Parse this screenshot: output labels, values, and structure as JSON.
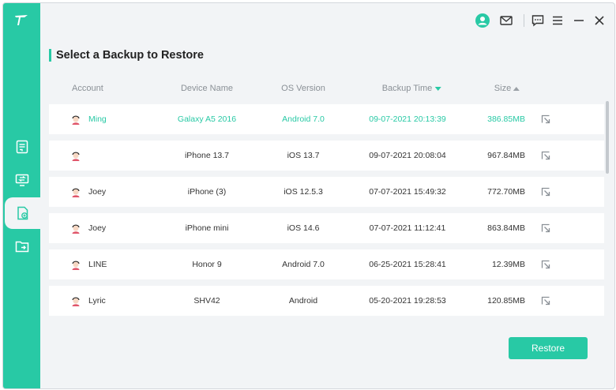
{
  "header": {
    "title": "Select a Backup to Restore"
  },
  "table": {
    "columns": {
      "account": "Account",
      "device": "Device Name",
      "os": "OS Version",
      "time": "Backup Time",
      "size": "Size"
    },
    "sort": {
      "time": "descending",
      "size": "ascending"
    },
    "rows": [
      {
        "account": "Ming",
        "device": "Galaxy A5 2016",
        "os": "Android 7.0",
        "time": "09-07-2021 20:13:39",
        "size": "386.85MB",
        "selected": true
      },
      {
        "account": "",
        "device": "iPhone 13.7",
        "os": "iOS 13.7",
        "time": "09-07-2021 20:08:04",
        "size": "967.84MB",
        "selected": false
      },
      {
        "account": "Joey",
        "device": "iPhone (3)",
        "os": "iOS 12.5.3",
        "time": "07-07-2021 15:49:32",
        "size": "772.70MB",
        "selected": false
      },
      {
        "account": "Joey",
        "device": "iPhone mini",
        "os": "iOS 14.6",
        "time": "07-07-2021 11:12:41",
        "size": "863.84MB",
        "selected": false
      },
      {
        "account": "LINE",
        "device": "Honor 9",
        "os": "Android 7.0",
        "time": "06-25-2021 15:28:41",
        "size": "12.39MB",
        "selected": false
      },
      {
        "account": "Lyric",
        "device": "SHV42",
        "os": "Android",
        "time": "05-20-2021 19:28:53",
        "size": "120.85MB",
        "selected": false
      }
    ]
  },
  "footer": {
    "restore_label": "Restore"
  },
  "icons": {
    "logo": "app-logo-icon",
    "nav": [
      "backup-icon",
      "transfer-icon",
      "restore-icon",
      "export-icon"
    ],
    "topbar": [
      "user-icon",
      "mail-icon",
      "feedback-icon",
      "menu-icon",
      "minimize-icon",
      "close-icon"
    ],
    "row_action": "open-icon"
  },
  "colors": {
    "accent": "#28c9a5",
    "background": "#f2f4f6",
    "row": "#ffffff"
  }
}
